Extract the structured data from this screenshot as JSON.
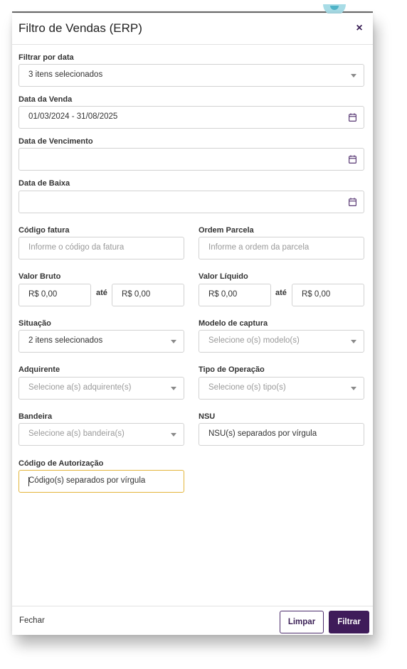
{
  "modal": {
    "title": "Filtro de Vendas (ERP)",
    "close_glyph": "×"
  },
  "fields": {
    "filtrar_por_data": {
      "label": "Filtrar por data",
      "value": "3 itens selecionados"
    },
    "data_venda": {
      "label": "Data da Venda",
      "value": "01/03/2024 - 31/08/2025"
    },
    "data_vencimento": {
      "label": "Data de Vencimento",
      "value": ""
    },
    "data_baixa": {
      "label": "Data de Baixa",
      "value": ""
    },
    "codigo_fatura": {
      "label": "Código fatura",
      "placeholder": "Informe o código da fatura"
    },
    "ordem_parcela": {
      "label": "Ordem Parcela",
      "placeholder": "Informe a ordem da parcela"
    },
    "valor_bruto": {
      "label": "Valor Bruto",
      "from": "R$ 0,00",
      "to": "R$ 0,00",
      "separator": "até"
    },
    "valor_liquido": {
      "label": "Valor Líquido",
      "from": "R$ 0,00",
      "to": "R$ 0,00",
      "separator": "até"
    },
    "situacao": {
      "label": "Situação",
      "value": "2 itens selecionados"
    },
    "modelo_captura": {
      "label": "Modelo de captura",
      "placeholder": "Selecione o(s) modelo(s)"
    },
    "adquirente": {
      "label": "Adquirente",
      "placeholder": "Selecione a(s) adquirente(s)"
    },
    "tipo_operacao": {
      "label": "Tipo de Operação",
      "placeholder": "Selecione o(s) tipo(s)"
    },
    "bandeira": {
      "label": "Bandeira",
      "placeholder": "Selecione a(s) bandeira(s)"
    },
    "nsu": {
      "label": "NSU",
      "placeholder": "NSU(s) separados por vírgula"
    },
    "codigo_autorizacao": {
      "label": "Código de Autorização",
      "placeholder": "Código(s) separados por vírgula"
    }
  },
  "footer": {
    "close_label": "Fechar",
    "clear_label": "Limpar",
    "filter_label": "Filtrar"
  },
  "icons": {
    "dropdown": "chevron-down-icon",
    "calendar": "calendar-icon",
    "close": "close-icon"
  },
  "colors": {
    "brand": "#3f1c5a",
    "focus_border": "#e3b53b",
    "calendar_icon": "#5a3a75"
  }
}
